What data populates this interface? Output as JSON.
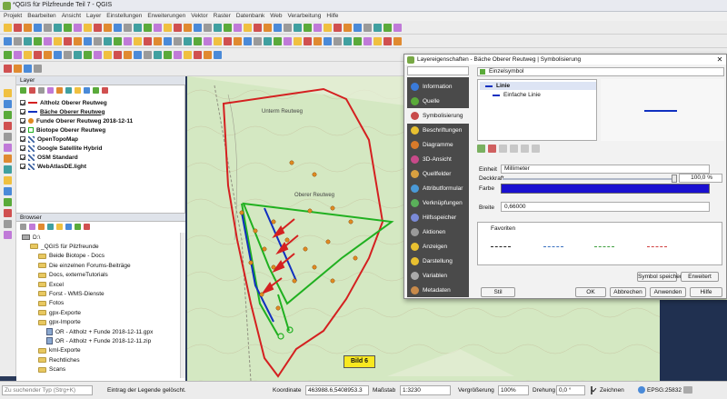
{
  "window": {
    "title": "*QGIS für Pilzfreunde Teil 7 - QGIS"
  },
  "menu": [
    "Projekt",
    "Bearbeiten",
    "Ansicht",
    "Layer",
    "Einstellungen",
    "Erweiterungen",
    "Vektor",
    "Raster",
    "Datenbank",
    "Web",
    "Verarbeitung",
    "Hilfe"
  ],
  "layers_panel": {
    "title": "Layer",
    "layers": [
      {
        "name": "Altholz Oberer Reutweg",
        "checked": true,
        "symbol": "red-line"
      },
      {
        "name": "Bäche Oberer Reutweg",
        "checked": true,
        "symbol": "blue-line"
      },
      {
        "name": "Funde Oberer Reutweg 2018-12-11",
        "checked": true,
        "symbol": "orange-dot"
      },
      {
        "name": "Biotope Oberer Reutweg",
        "checked": true,
        "symbol": "green-box"
      },
      {
        "name": "OpenTopoMap",
        "checked": true,
        "symbol": "raster"
      },
      {
        "name": "Google Satellite Hybrid",
        "checked": true,
        "symbol": "raster"
      },
      {
        "name": "OSM Standard",
        "checked": true,
        "symbol": "raster"
      },
      {
        "name": "WebAtlasDE.light",
        "checked": true,
        "symbol": "raster"
      }
    ]
  },
  "browser_panel": {
    "title": "Browser",
    "items": [
      {
        "label": "D:\\",
        "level": 0,
        "type": "drive"
      },
      {
        "label": "_QGIS für Pilzfreunde",
        "level": 1,
        "type": "folder"
      },
      {
        "label": "Beide Biotope - Docs",
        "level": 2,
        "type": "folder"
      },
      {
        "label": "Die einzelnen Forums-Beiträge",
        "level": 2,
        "type": "folder"
      },
      {
        "label": "Docs, externeTutorials",
        "level": 2,
        "type": "folder"
      },
      {
        "label": "Excel",
        "level": 2,
        "type": "folder"
      },
      {
        "label": "Forst - WMS-Dienste",
        "level": 2,
        "type": "folder"
      },
      {
        "label": "Fotos",
        "level": 2,
        "type": "folder"
      },
      {
        "label": "gpx-Exporte",
        "level": 2,
        "type": "folder"
      },
      {
        "label": "gpx-Importe",
        "level": 2,
        "type": "folder"
      },
      {
        "label": "OR - Altholz + Funde 2018-12-11.gpx",
        "level": 3,
        "type": "file"
      },
      {
        "label": "OR - Altholz + Funde 2018-12-11.zip",
        "level": 3,
        "type": "file"
      },
      {
        "label": "kml-Exporte",
        "level": 2,
        "type": "folder"
      },
      {
        "label": "Rechtliches",
        "level": 2,
        "type": "folder"
      },
      {
        "label": "Scans",
        "level": 2,
        "type": "folder"
      }
    ]
  },
  "map": {
    "labels": [
      "Unterm Reutweg",
      "Oberer Reutweg",
      "Bild 6"
    ],
    "colors": {
      "red": "#d42020",
      "blue": "#1030c0",
      "green": "#20b020",
      "orange": "#e08a20",
      "map_bg": "#d4e8c2"
    }
  },
  "dialog": {
    "title": "Layereigenschaften - Bäche Oberer Reutweg | Symbolisierung",
    "renderer": "Einzelsymbol",
    "nav": [
      {
        "label": "Information",
        "icon": "info-icon",
        "color": "#3a7ad8"
      },
      {
        "label": "Quelle",
        "icon": "source-icon",
        "color": "#5aaa3a"
      },
      {
        "label": "Symbolisierung",
        "icon": "paint-icon",
        "color": "#c84a4a"
      },
      {
        "label": "Beschriftungen",
        "icon": "label-icon",
        "color": "#e8c030"
      },
      {
        "label": "Diagramme",
        "icon": "chart-icon",
        "color": "#d87a2a"
      },
      {
        "label": "3D-Ansicht",
        "icon": "cube-icon",
        "color": "#c84a8a"
      },
      {
        "label": "Quellfelder",
        "icon": "table-icon",
        "color": "#d8a040"
      },
      {
        "label": "Attributformular",
        "icon": "form-icon",
        "color": "#4a9ad8"
      },
      {
        "label": "Verknüpfungen",
        "icon": "join-icon",
        "color": "#5ab05a"
      },
      {
        "label": "Hilfsspeicher",
        "icon": "storage-icon",
        "color": "#7a8ad8"
      },
      {
        "label": "Aktionen",
        "icon": "gear-icon",
        "color": "#9a9a9a"
      },
      {
        "label": "Anzeigen",
        "icon": "display-icon",
        "color": "#e8c030"
      },
      {
        "label": "Darstellung",
        "icon": "render-icon",
        "color": "#e8c030"
      },
      {
        "label": "Variablen",
        "icon": "variables-icon",
        "color": "#aaaaaa"
      },
      {
        "label": "Metadaten",
        "icon": "metadata-icon",
        "color": "#c88a4a"
      }
    ],
    "symbol_tree": {
      "root": "Linie",
      "child": "Einfache Linie"
    },
    "einheit_label": "Einheit",
    "einheit_value": "Millimeter",
    "deckkraft_label": "Deckkraft",
    "deckkraft_value": "100,0 %",
    "farbe_label": "Farbe",
    "farbe_color": "#1a10d0",
    "breite_label": "Breite",
    "breite_value": "0,66000",
    "favoriten_label": "Favoriten",
    "buttons": {
      "save_symbol": "Symbol speichern",
      "advanced": "Erweitert",
      "style": "Stil",
      "ok": "OK",
      "cancel": "Abbrechen",
      "apply": "Anwenden",
      "help": "Hilfe"
    }
  },
  "statusbar": {
    "search_placeholder": "Zu suchender Typ (Strg+K)",
    "message": "Eintrag der Legende gelöscht.",
    "coord_label": "Koordinate",
    "coord_value": "463988.6,5408953.3",
    "scale_label": "Maßstab",
    "scale_value": "1:3230",
    "magnifier_label": "Vergrößerung",
    "magnifier_value": "100%",
    "rotation_label": "Drehung",
    "rotation_value": "0,0 °",
    "render_label": "Zeichnen",
    "crs": "EPSG:25832"
  }
}
